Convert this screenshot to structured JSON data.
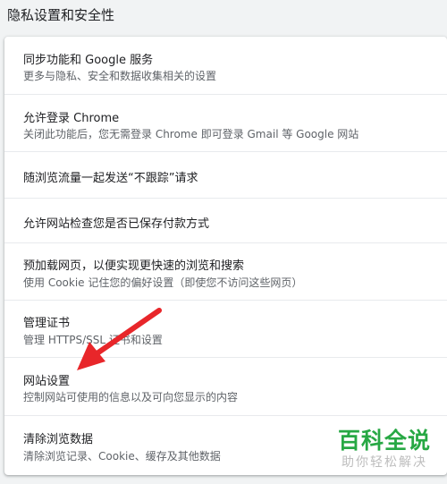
{
  "section": {
    "title": "隐私设置和安全性"
  },
  "settings": [
    {
      "label": "同步功能和 Google 服务",
      "sub": "更多与隐私、安全和数据收集相关的设置"
    },
    {
      "label": "允许登录 Chrome",
      "sub": "关闭此功能后，您无需登录 Chrome 即可登录 Gmail 等 Google 网站"
    },
    {
      "label": "随浏览流量一起发送“不跟踪”请求",
      "sub": ""
    },
    {
      "label": "允许网站检查您是否已保存付款方式",
      "sub": ""
    },
    {
      "label": "预加载网页，以便实现更快速的浏览和搜索",
      "sub": "使用 Cookie 记住您的偏好设置（即使您不访问这些网页）"
    },
    {
      "label": "管理证书",
      "sub": "管理 HTTPS/SSL 证书和设置"
    },
    {
      "label": "网站设置",
      "sub": "控制网站可使用的信息以及可向您显示的内容"
    },
    {
      "label": "清除浏览数据",
      "sub": "清除浏览记录、Cookie、缓存及其他数据"
    }
  ],
  "annotation": {
    "arrow_color": "#e8262a",
    "points_to": "网站设置"
  },
  "watermark": {
    "main": "百科全说",
    "sub": "助你轻松解决",
    "color": "#27a844"
  }
}
